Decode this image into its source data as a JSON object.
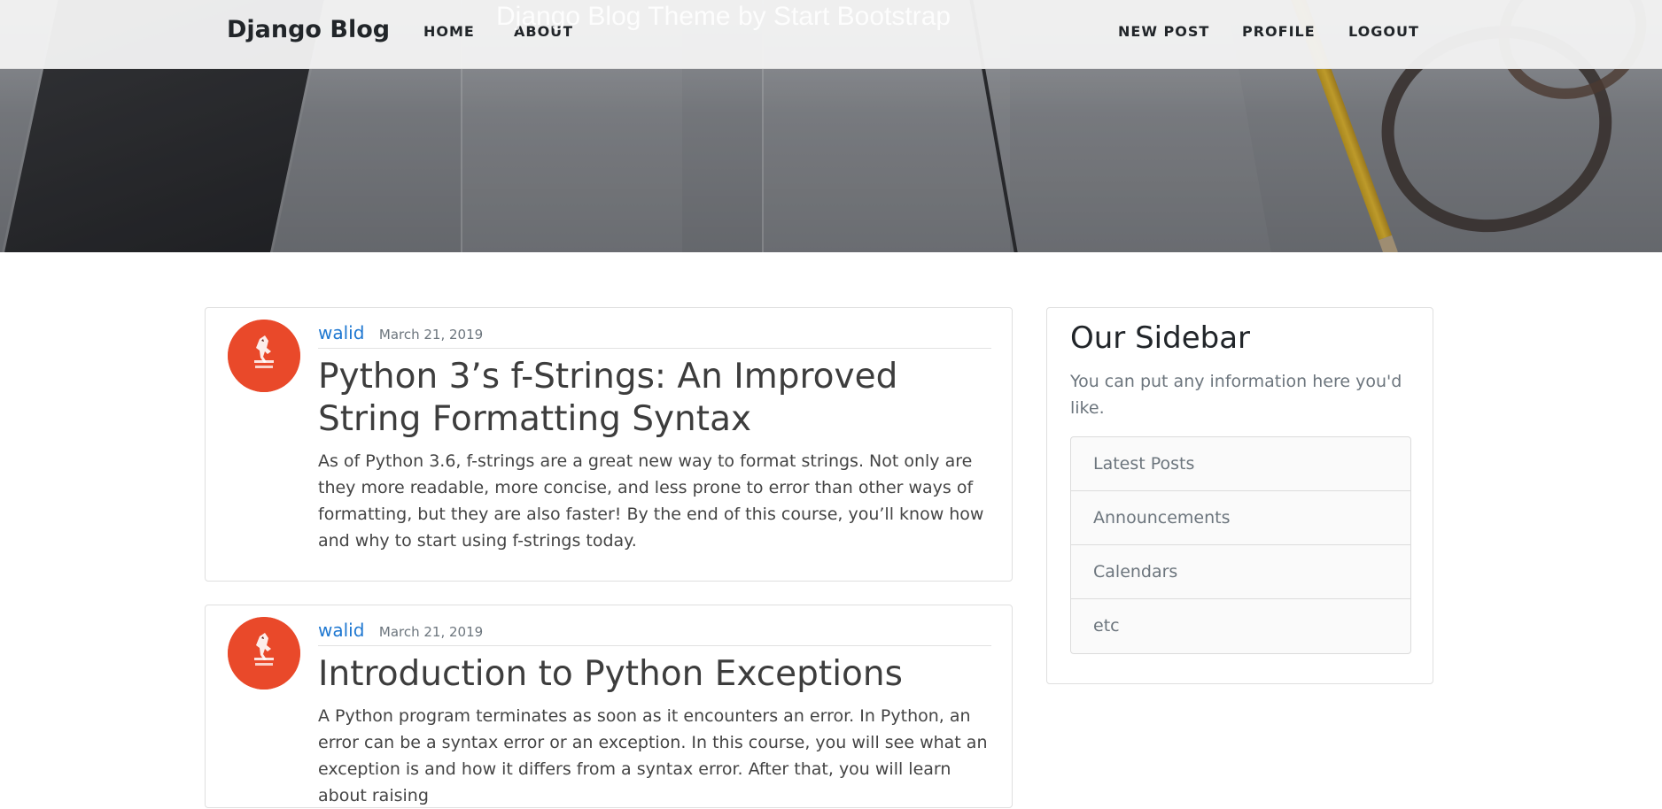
{
  "hero": {
    "subtitle": "Django Blog Theme by Start Bootstrap"
  },
  "navbar": {
    "brand": "Django Blog",
    "left_links": [
      "HOME",
      "ABOUT"
    ],
    "right_links": [
      "NEW POST",
      "PROFILE",
      "LOGOUT"
    ]
  },
  "posts": [
    {
      "author": "walid",
      "date": "March 21, 2019",
      "title": "Python 3’s f-Strings: An Improved String Formatting Syntax",
      "body": "As of Python 3.6, f-strings are a great new way to format strings. Not only are they more readable, more concise, and less prone to error than other ways of formatting, but they are also faster! By the end of this course, you’ll know how and why to start using f-strings today."
    },
    {
      "author": "walid",
      "date": "March 21, 2019",
      "title": "Introduction to Python Exceptions",
      "body": "A Python program terminates as soon as it encounters an error. In Python, an error can be a syntax error or an exception. In this course, you will see what an exception is and how it differs from a syntax error. After that, you will learn about raising"
    }
  ],
  "sidebar": {
    "title": "Our Sidebar",
    "description": "You can put any information here you'd like.",
    "items": [
      "Latest Posts",
      "Announcements",
      "Calendars",
      "etc"
    ]
  },
  "colors": {
    "link": "#1f78d1",
    "avatar_bg": "#e9492a",
    "navbar_bg": "#f3f3f3"
  },
  "icons": {
    "avatar": "django-pony-avatar-icon"
  }
}
